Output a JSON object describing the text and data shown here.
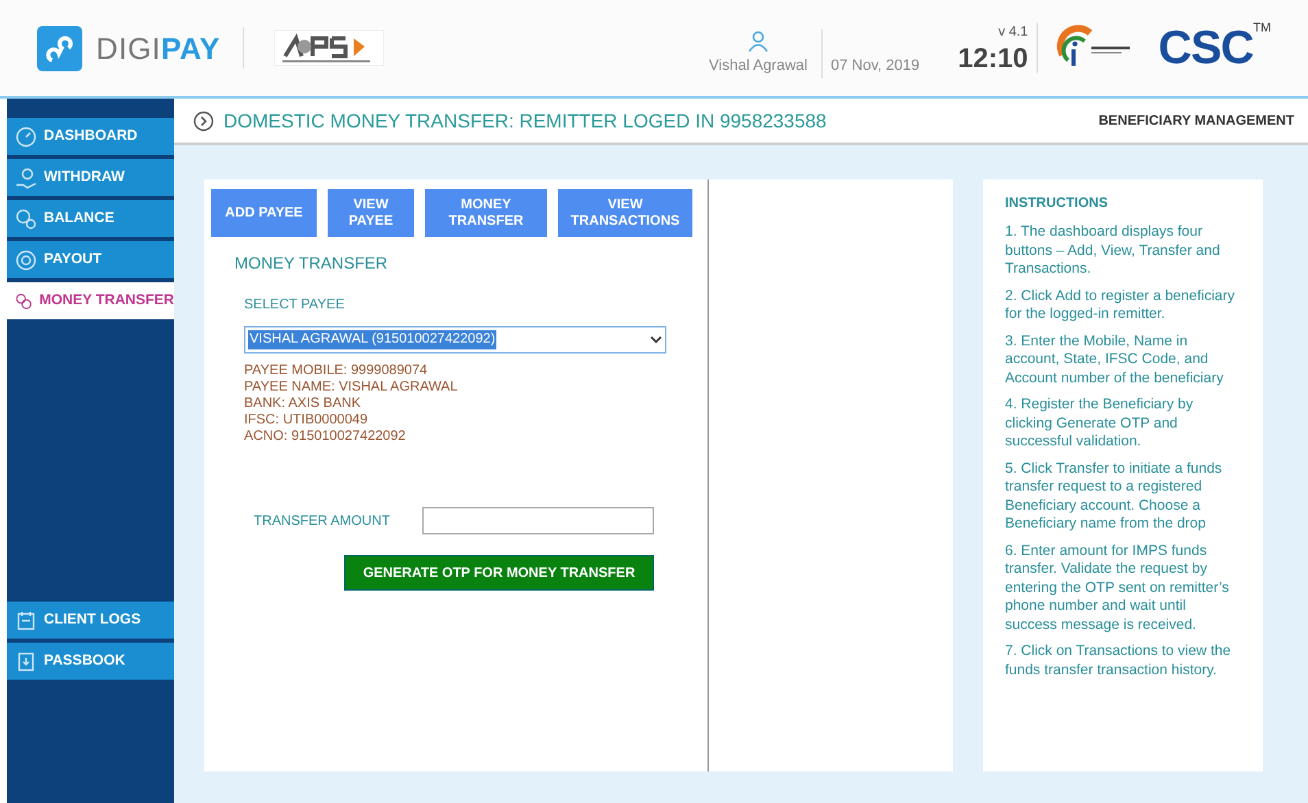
{
  "header": {
    "brand_light": "DIGI",
    "brand_bold": "PAY",
    "user_name": "Vishal Agrawal",
    "date": "07 Nov, 2019",
    "version": "v 4.1",
    "time": "12:10",
    "csc_logo": "CSC",
    "csc_tm": "TM"
  },
  "sidebar": {
    "items": [
      {
        "label": "DASHBOARD",
        "selected": false
      },
      {
        "label": "WITHDRAW",
        "selected": false
      },
      {
        "label": "BALANCE",
        "selected": false
      },
      {
        "label": "PAYOUT",
        "selected": false
      },
      {
        "label": "MONEY TRANSFER",
        "selected": true
      }
    ],
    "bottom_items": [
      {
        "label": "CLIENT LOGS",
        "selected": false
      },
      {
        "label": "PASSBOOK",
        "selected": false
      }
    ]
  },
  "page": {
    "title": "DOMESTIC MONEY TRANSFER: REMITTER LOGED IN 9958233588",
    "section": "BENEFICIARY MANAGEMENT"
  },
  "buttons": [
    {
      "line1": "ADD PAYEE"
    },
    {
      "line1": "VIEW",
      "line2": "PAYEE"
    },
    {
      "line1": "MONEY",
      "line2": "TRANSFER"
    },
    {
      "line1": "VIEW",
      "line2": "TRANSACTIONS"
    }
  ],
  "form": {
    "heading": "MONEY TRANSFER",
    "select_label": "SELECT PAYEE",
    "select_value": "VISHAL AGRAWAL (915010027422092)",
    "details": [
      "PAYEE MOBILE: 9999089074",
      "PAYEE NAME: VISHAL AGRAWAL",
      "BANK: AXIS BANK",
      "IFSC: UTIB0000049",
      "ACNO: 915010027422092"
    ],
    "amount_label": "TRANSFER AMOUNT",
    "submit": "GENERATE OTP  FOR MONEY TRANSFER"
  },
  "instructions": {
    "title": "INSTRUCTIONS",
    "steps": [
      "1. The dashboard displays four buttons – Add, View, Transfer and Transactions.",
      "2. Click Add to register a beneficiary for the logged-in remitter.",
      "3. Enter the Mobile, Name in account, State, IFSC Code, and Account number of the beneficiary",
      "4. Register the Beneficiary by clicking Generate OTP and successful validation.",
      "5. Click Transfer to initiate a funds transfer request to a registered Beneficiary account. Choose a Beneficiary name from the drop",
      "6. Enter amount for IMPS funds transfer. Validate the request by entering the OTP sent on remitter’s phone number and wait until success message is received.",
      "7. Click on Transactions to view the funds transfer transaction history."
    ]
  }
}
